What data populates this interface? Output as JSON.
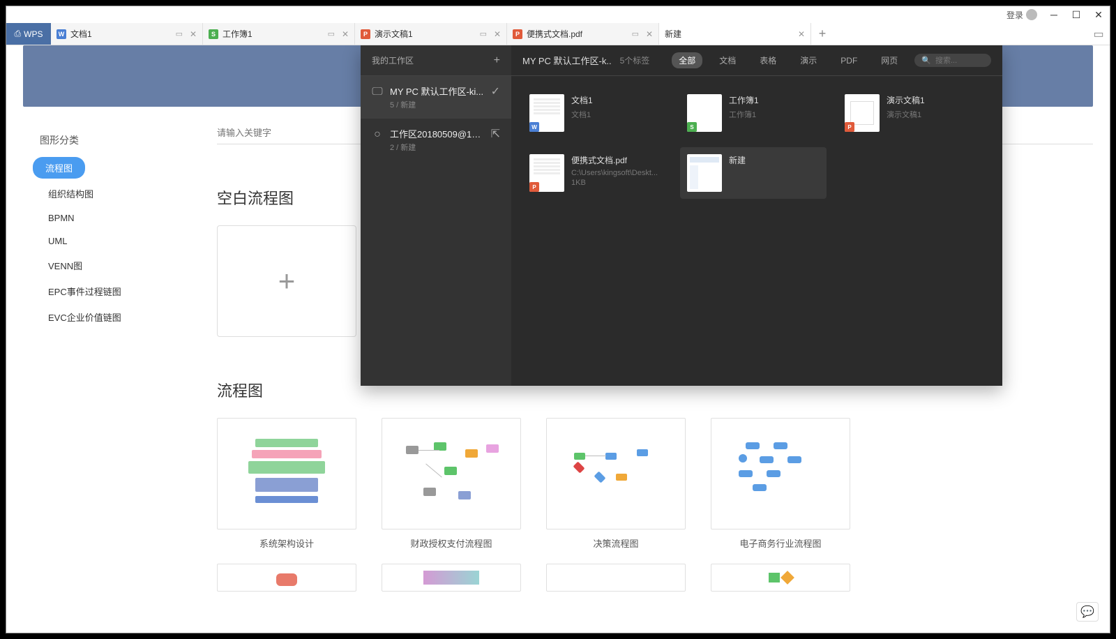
{
  "titlebar": {
    "login": "登录"
  },
  "tabs": {
    "wps": "WPS",
    "items": [
      {
        "label": "文档1",
        "type": "w"
      },
      {
        "label": "工作簿1",
        "type": "s"
      },
      {
        "label": "演示文稿1",
        "type": "p"
      },
      {
        "label": "便携式文档.pdf",
        "type": "pdf"
      },
      {
        "label": "新建",
        "type": "none",
        "active": true
      }
    ]
  },
  "sidebar": {
    "title": "图形分类",
    "items": [
      "流程图",
      "组织结构图",
      "BPMN",
      "UML",
      "VENN图",
      "EPC事件过程链图",
      "EVC企业价值链图"
    ]
  },
  "main": {
    "search_placeholder": "请输入关键字",
    "blank_title": "空白流程图",
    "flow_title": "流程图",
    "templates": [
      "系统架构设计",
      "财政授权支付流程图",
      "决策流程图",
      "电子商务行业流程图"
    ]
  },
  "overlay": {
    "left_title": "我的工作区",
    "workspaces": [
      {
        "name": "MY PC 默认工作区-ki...",
        "sub": "5 / 新建",
        "selected": true,
        "check": true
      },
      {
        "name": "工作区20180509@14...",
        "sub": "2 / 新建",
        "selected": false,
        "external": true
      }
    ],
    "right_title": "MY PC  默认工作区-k..",
    "count": "5个标签",
    "filters": [
      "全部",
      "文档",
      "表格",
      "演示",
      "PDF",
      "网页"
    ],
    "search_placeholder": "搜索...",
    "docs": [
      {
        "name": "文档1",
        "sub": "文档1",
        "type": "w",
        "thumb": "doc"
      },
      {
        "name": "工作簿1",
        "sub": "工作簿1",
        "type": "s",
        "thumb": "sheet"
      },
      {
        "name": "演示文稿1",
        "sub": "演示文稿1",
        "type": "p",
        "thumb": "pres"
      },
      {
        "name": "便携式文档.pdf",
        "sub": "C:\\Users\\kingsoft\\Deskt...",
        "sub2": "1KB",
        "type": "pdf",
        "thumb": "doc"
      },
      {
        "name": "新建",
        "sub": "",
        "type": "none",
        "thumb": "new",
        "highlighted": true
      }
    ]
  }
}
